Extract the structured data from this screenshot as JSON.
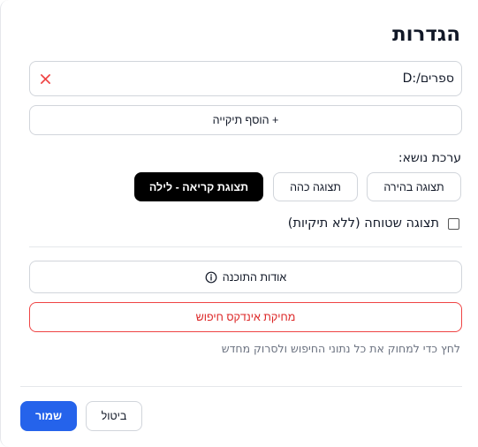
{
  "dialog": {
    "title": "הגדרות"
  },
  "folders": [
    {
      "path": "D:/ספרים"
    }
  ],
  "add_folder_label": "+ הוסף תיקייה",
  "theme": {
    "label": "ערכת נושא:",
    "options": [
      {
        "label": "תצוגה בהירה",
        "selected": false
      },
      {
        "label": "תצוגה כהה",
        "selected": false
      },
      {
        "label": "תצוגת קריאה - לילה",
        "selected": true
      }
    ]
  },
  "flat_view": {
    "label": "תצוגה שטוחה (ללא תיקיות)",
    "checked": false
  },
  "about_label": "אודות התוכנה",
  "clear_index": {
    "label": "מחיקת אינדקס חיפוש",
    "help": "לחץ כדי למחוק את כל נתוני החיפוש ולסרוק מחדש"
  },
  "footer": {
    "save_label": "שמור",
    "cancel_label": "ביטול"
  },
  "colors": {
    "primary": "#2563eb",
    "danger": "#dc2626",
    "selected_theme_bg": "#000000"
  }
}
